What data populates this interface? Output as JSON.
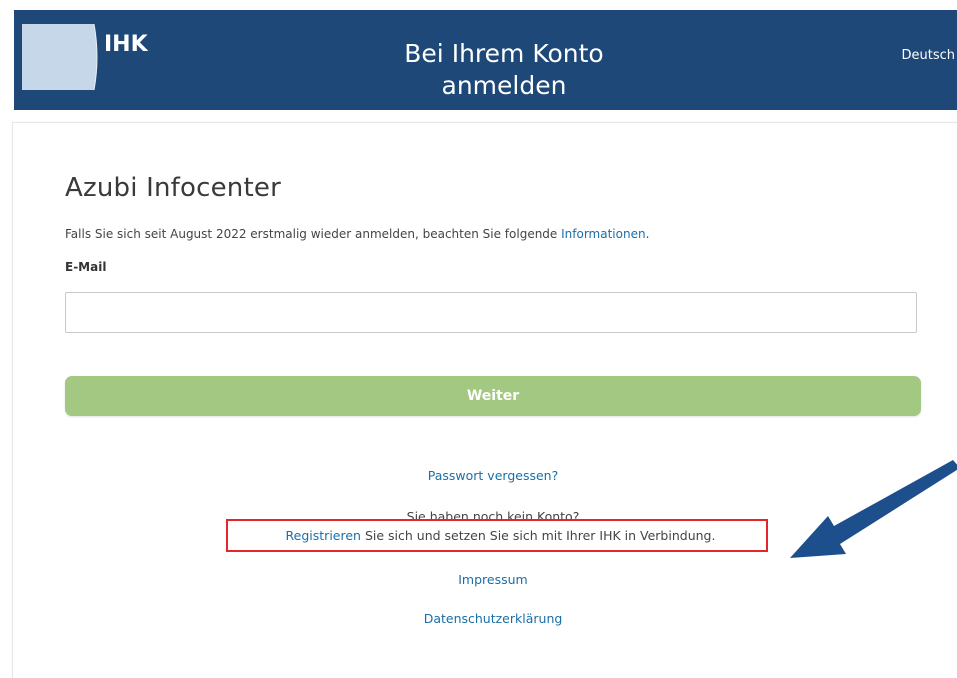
{
  "header": {
    "logo_text": "IHK",
    "title_line1": "Bei Ihrem Konto",
    "title_line2": "anmelden",
    "language": "Deutsch"
  },
  "main": {
    "app_title": "Azubi Infocenter",
    "info_prefix": "Falls Sie sich seit August 2022 erstmalig wieder anmelden, beachten Sie folgende ",
    "info_link": "Informationen",
    "info_suffix": ".",
    "email_label": "E-Mail",
    "email_value": "",
    "submit_label": "Weiter",
    "forgot_password": "Passwort vergessen?",
    "no_account": "Sie haben noch kein Konto?",
    "register_link": "Registrieren",
    "register_suffix": " Sie sich und setzen Sie sich mit Ihrer IHK in Verbindung.",
    "imprint": "Impressum",
    "privacy": "Datenschutzerklärung"
  },
  "colors": {
    "header_bg": "#1d4877",
    "button_bg": "#a3c882",
    "link": "#1a6fa8",
    "highlight": "#e3262b",
    "arrow": "#1d4f8c"
  },
  "annotations": {
    "highlight": "red-rectangle",
    "pointer": "blue-arrow"
  }
}
